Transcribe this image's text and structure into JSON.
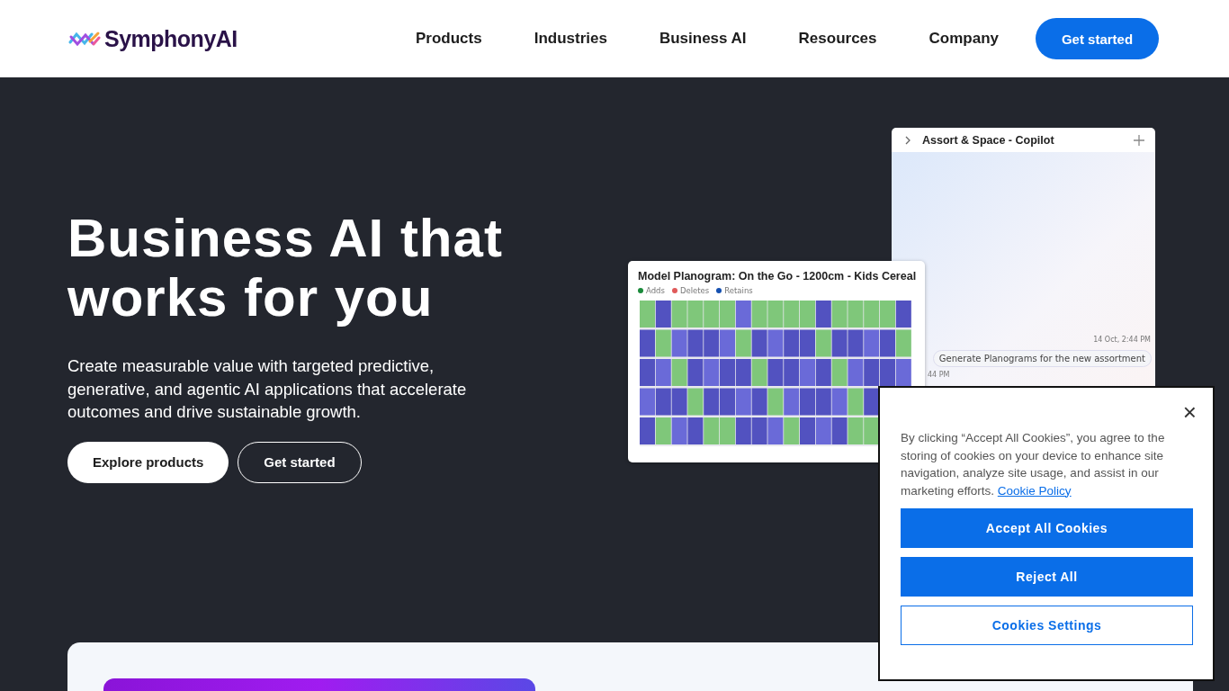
{
  "header": {
    "logo": "SymphonyAI",
    "nav": [
      {
        "label": "Products"
      },
      {
        "label": "Industries"
      },
      {
        "label": "Business AI"
      },
      {
        "label": "Resources"
      },
      {
        "label": "Company"
      }
    ],
    "cta": "Get started"
  },
  "hero": {
    "title": "Business AI that works for you",
    "subtitle": "Create measurable value with targeted predictive, generative, and agentic AI applications that accelerate outcomes and drive sustainable growth.",
    "buttons": [
      {
        "label": "Explore products",
        "kind": "primary"
      },
      {
        "label": "Get started",
        "kind": "outline"
      }
    ]
  },
  "copilot": {
    "title": "Assort & Space - Copilot",
    "timestamp": "14 Oct, 2:44 PM",
    "message": "Generate Planograms for the new assortment",
    "timestamp_2": "44 PM"
  },
  "planogram": {
    "title": "Model Planogram: On the Go - 1200cm - Kids Cereal",
    "legend": [
      {
        "label": "Adds",
        "color": "#1a8a3a"
      },
      {
        "label": "Deletes",
        "color": "#e05a5a"
      },
      {
        "label": "Retains",
        "color": "#1550b0"
      }
    ],
    "kind": "picture"
  },
  "cookie_dialog": {
    "text": "By clicking “Accept All Cookies”, you agree to the storing of cookies on your device to enhance site navigation, analyze site usage, and assist in our marketing efforts.",
    "link": "Cookie Policy",
    "close": "×",
    "buttons": [
      {
        "label": "Accept All Cookies",
        "kind": "primary"
      },
      {
        "label": "Reject All",
        "kind": "primary"
      },
      {
        "label": "Cookies Settings",
        "kind": "outline"
      }
    ]
  }
}
